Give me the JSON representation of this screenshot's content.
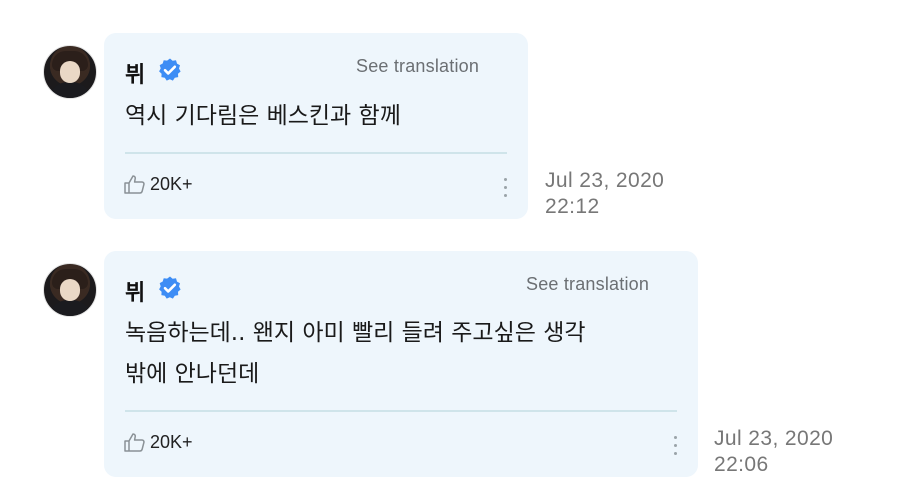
{
  "posts": [
    {
      "author": "뷔",
      "see_translation": "See translation",
      "message_lines": [
        "역시 기다림은 베스킨과 함께"
      ],
      "likes": "20K+",
      "date": "Jul 23, 2020",
      "time": "22:12"
    },
    {
      "author": "뷔",
      "see_translation": "See translation",
      "message_lines": [
        "녹음하는데.. 왠지 아미 빨리 들려 주고싶은 생각",
        "밖에 안나던데"
      ],
      "likes": "20K+",
      "date": "Jul 23, 2020",
      "time": "22:06"
    }
  ],
  "colors": {
    "bubble": "#eef6fc",
    "verified": "#3d8df5",
    "muted_text": "#777777"
  },
  "icons": {
    "verified": "verified-badge-icon",
    "like": "thumbs-up-icon",
    "more": "more-vertical-icon"
  }
}
